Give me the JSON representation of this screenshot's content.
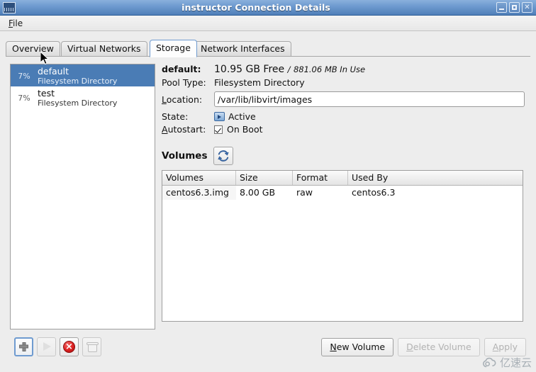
{
  "window": {
    "title": "instructor Connection Details",
    "app_icon": "server-icon",
    "controls": {
      "minimize": "minimize-icon",
      "maximize": "maximize-icon",
      "close": "✕"
    }
  },
  "menubar": {
    "items": [
      {
        "label_pre": "",
        "accel": "F",
        "label_post": "ile"
      }
    ]
  },
  "tabs": [
    {
      "label": "Overview",
      "active": false
    },
    {
      "label": "Virtual Networks",
      "active": false
    },
    {
      "label": "Storage",
      "active": true
    },
    {
      "label": "Network Interfaces",
      "active": false
    }
  ],
  "pool_list": [
    {
      "percent": "7%",
      "name": "default",
      "type": "Filesystem Directory",
      "selected": true
    },
    {
      "percent": "7%",
      "name": "test",
      "type": "Filesystem Directory",
      "selected": false
    }
  ],
  "detail": {
    "pool_name_label": "default:",
    "free_space": "10.95 GB Free",
    "in_use_separator": "/",
    "in_use": "881.06 MB In Use",
    "pool_type_label": "Pool Type:",
    "pool_type_value": "Filesystem Directory",
    "location_label_pre": "",
    "location_accel": "L",
    "location_label_post": "ocation:",
    "location_value": "/var/lib/libvirt/images",
    "state_label": "State:",
    "state_value": "Active",
    "state_icon": "monitor-play-icon",
    "autostart_accel": "A",
    "autostart_label_post": "utostart:",
    "autostart_value": "On Boot",
    "autostart_checked": true
  },
  "volumes_section": {
    "heading": "Volumes",
    "refresh_icon": "refresh-icon",
    "columns": [
      {
        "label": "Volumes",
        "sortable": true
      },
      {
        "label": "Size",
        "sortable": false
      },
      {
        "label": "Format",
        "sortable": false
      },
      {
        "label": "Used By",
        "sortable": false
      }
    ],
    "rows": [
      {
        "volume": "centos6.3.img",
        "size": "8.00 GB",
        "format": "raw",
        "used_by": "centos6.3"
      }
    ]
  },
  "pool_toolbar": [
    {
      "icon": "plus-icon",
      "state": "focused"
    },
    {
      "icon": "play-icon",
      "state": "disabled"
    },
    {
      "icon": "stop-icon",
      "state": "enabled"
    },
    {
      "icon": "trash-icon",
      "state": "disabled"
    }
  ],
  "action_buttons": [
    {
      "accel": "N",
      "label_post": "ew Volume",
      "disabled": false
    },
    {
      "accel": "D",
      "label_post": "elete Volume",
      "disabled": true
    },
    {
      "accel": "A",
      "label_post": "pply",
      "disabled": true
    }
  ],
  "watermark": {
    "text": "亿速云",
    "icon": "cloud-icon"
  },
  "colors": {
    "titlebar_accent": "#4f7fb8",
    "selection_blue": "#4a7cb5",
    "active_tab_border": "#6f9bd0",
    "stop_red": "#dc2020",
    "refresh_blue": "#2f5fa0",
    "window_bg": "#ededed"
  }
}
